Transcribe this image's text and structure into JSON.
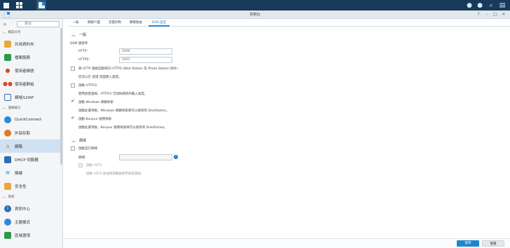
{
  "window": {
    "title": "控制台"
  },
  "search": {
    "placeholder": "搜尋"
  },
  "sidebar": {
    "sections": [
      {
        "label": "檔案分享"
      },
      {
        "label": "連線能力"
      },
      {
        "label": "系統"
      }
    ],
    "items": [
      {
        "label": "共用資料夾",
        "icon": "shared-folder-icon",
        "color": "#e9a83a"
      },
      {
        "label": "檔案服務",
        "icon": "file-services-icon",
        "color": "#2d9a4b"
      },
      {
        "label": "使用者帳號",
        "icon": "user-icon",
        "color": "#d9472b"
      },
      {
        "label": "使用者群組",
        "icon": "group-icon",
        "color": "#d9472b"
      },
      {
        "label": "網域/LDAP",
        "icon": "domain-ldap-icon",
        "color": "#3a6fb5"
      },
      {
        "label": "QuickConnect",
        "icon": "quickconnect-icon",
        "color": "#2b8ad6"
      },
      {
        "label": "外部存取",
        "icon": "external-access-icon",
        "color": "#e07b22"
      },
      {
        "label": "網路",
        "icon": "network-icon",
        "color": "#e07b22"
      },
      {
        "label": "DHCP 伺服器",
        "icon": "dhcp-server-icon",
        "color": "#2b6fb5"
      },
      {
        "label": "無線",
        "icon": "wireless-icon",
        "color": "#2b8ad6"
      },
      {
        "label": "安全性",
        "icon": "security-icon",
        "color": "#e9a83a"
      },
      {
        "label": "資訊中心",
        "icon": "info-center-icon",
        "color": "#2b6fb5"
      },
      {
        "label": "主題樣式",
        "icon": "theme-icon",
        "color": "#2b8ad6"
      },
      {
        "label": "區域選項",
        "icon": "regional-options-icon",
        "color": "#2d9a4b"
      }
    ]
  },
  "tabs": [
    "一般",
    "網路介面",
    "流量控制",
    "靜態路由",
    "DSM 設定"
  ],
  "content": {
    "general_section": "一般",
    "dsm_port_label": "DSM 連接埠",
    "http_label": "HTTP:",
    "http_value": "5000",
    "https_label": "HTTPS:",
    "https_value": "5001",
    "redirect_label": "將 HTTP 連線自動導向 HTTPS (Web Station 及 Photo Station 除外)",
    "cert_link": "您可以在 憑證 頁面匯入憑證。",
    "http2_label": "啟動 HTTP/2",
    "http2_note": "使用加密連線，HTTP/2 可加快網頁的載入速度。",
    "windows_discovery_label": "啟動 Windows 網路探索",
    "windows_discovery_note": "啟動此選項後，Windows 網路探索將可以搜尋到 DiskStation。",
    "bonjour_label": "啟動 Bonjour 服務探索",
    "bonjour_note": "啟動此選項後，Bonjour 服務探索將可以搜尋到 DiskStation。",
    "advanced_section": "網域",
    "custom_domain_label": "啟動自訂網域",
    "domain_label": "網域:",
    "domain_value": "",
    "hsts_label": "啟動 HSTS",
    "hsts_note": "啟動 HSTS 後強制瀏覽器使用加密連線。"
  },
  "footer": {
    "apply": "套用",
    "reset": "重置"
  },
  "colors": {
    "accent": "#1e86cf",
    "taskbar": "#183a5a"
  }
}
